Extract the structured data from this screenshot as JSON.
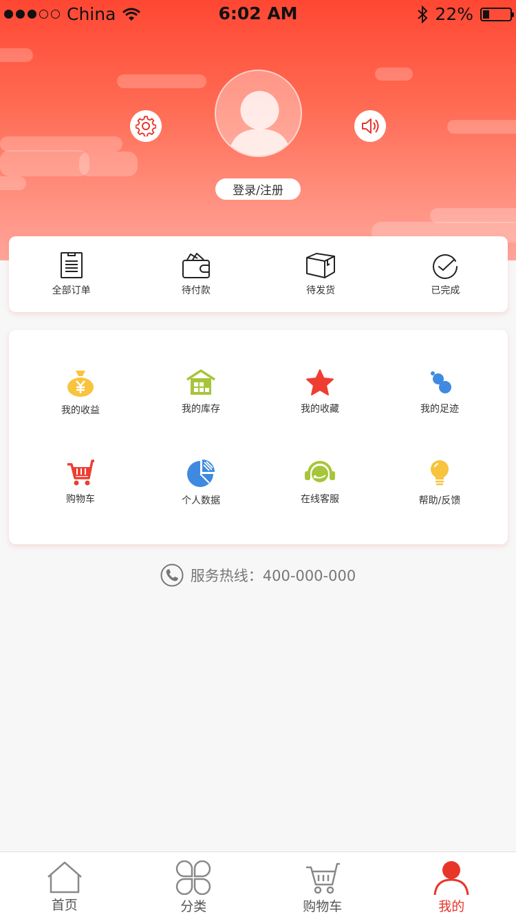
{
  "status_bar": {
    "carrier": "China",
    "time": "6:02 AM",
    "battery": "22%",
    "battery_level": 0.22
  },
  "header": {
    "settings_icon": "gear-icon",
    "sound_icon": "speaker-icon",
    "avatar_icon": "user-avatar-icon",
    "login_label": "登录/注册",
    "accent_color": "#ff4733"
  },
  "orders": [
    {
      "label": "全部订单",
      "icon": "order-list-icon"
    },
    {
      "label": "待付款",
      "icon": "wallet-icon"
    },
    {
      "label": "待发货",
      "icon": "package-icon"
    },
    {
      "label": "已完成",
      "icon": "check-circle-icon"
    }
  ],
  "services": [
    {
      "label": "我的收益",
      "icon": "money-bag-icon",
      "color": "#f8c33d"
    },
    {
      "label": "我的库存",
      "icon": "warehouse-icon",
      "color": "#a6c53a"
    },
    {
      "label": "我的收藏",
      "icon": "star-icon",
      "color": "#ef3d32"
    },
    {
      "label": "我的足迹",
      "icon": "footprint-icon",
      "color": "#3f8ae0"
    },
    {
      "label": "购物车",
      "icon": "cart-icon",
      "color": "#ef3d32"
    },
    {
      "label": "个人数据",
      "icon": "pie-chart-icon",
      "color": "#3f8ae0"
    },
    {
      "label": "在线客服",
      "icon": "headset-icon",
      "color": "#a6c53a"
    },
    {
      "label": "帮助/反馈",
      "icon": "lightbulb-icon",
      "color": "#f8c33d"
    }
  ],
  "hotline": {
    "text": "服务热线：400-000-000",
    "icon": "phone-icon"
  },
  "tabbar": {
    "active": 3,
    "active_color": "#e8352a",
    "tabs": [
      {
        "label": "首页",
        "icon": "home-icon"
      },
      {
        "label": "分类",
        "icon": "category-icon"
      },
      {
        "label": "购物车",
        "icon": "cart-icon"
      },
      {
        "label": "我的",
        "icon": "profile-icon"
      }
    ]
  }
}
